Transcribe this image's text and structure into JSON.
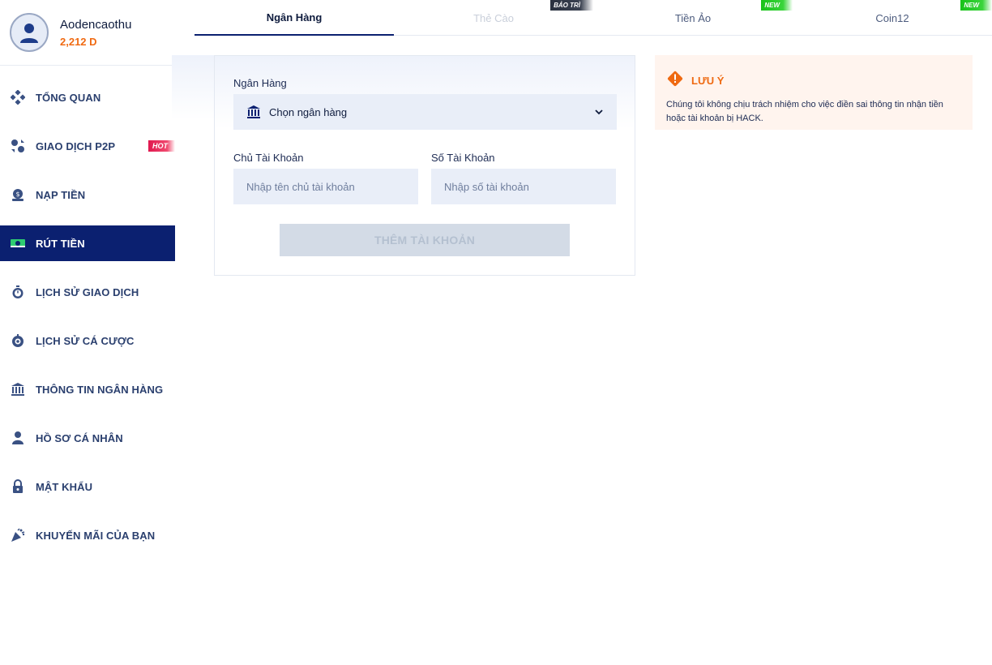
{
  "user": {
    "name": "Aodencaothu",
    "balance": "2,212 D"
  },
  "sidebar": {
    "items": [
      {
        "label": "TỔNG QUAN",
        "icon": "dashboard-icon"
      },
      {
        "label": "GIAO DỊCH P2P",
        "icon": "p2p-icon",
        "badge": "HOT"
      },
      {
        "label": "NẠP TIỀN",
        "icon": "deposit-icon"
      },
      {
        "label": "RÚT TIỀN",
        "icon": "withdraw-icon",
        "active": true
      },
      {
        "label": "LỊCH SỬ GIAO DỊCH",
        "icon": "stopwatch-icon"
      },
      {
        "label": "LỊCH SỬ CÁ CƯỢC",
        "icon": "bet-history-icon"
      },
      {
        "label": "THÔNG TIN NGÂN HÀNG",
        "icon": "bank-icon"
      },
      {
        "label": "HỒ SƠ CÁ NHÂN",
        "icon": "user-icon"
      },
      {
        "label": "MẬT KHẨU",
        "icon": "lock-icon"
      },
      {
        "label": "KHUYẾN MÃI CỦA BẠN",
        "icon": "promo-icon"
      }
    ]
  },
  "tabs": [
    {
      "label": "Ngân Hàng",
      "state": "active"
    },
    {
      "label": "Thẻ Cào",
      "state": "disabled",
      "badge": "BẢO TRÌ"
    },
    {
      "label": "Tiền Ảo",
      "state": "normal",
      "badge": "NEW"
    },
    {
      "label": "Coin12",
      "state": "normal",
      "badge": "NEW"
    }
  ],
  "form": {
    "bank_label": "Ngân Hàng",
    "bank_select_value": "Chọn ngân hàng",
    "owner_label": "Chủ Tài Khoản",
    "owner_placeholder": "Nhập tên chủ tài khoản",
    "number_label": "Số Tài Khoản",
    "number_placeholder": "Nhập số tài khoản",
    "submit_label": "THÊM TÀI KHOẢN"
  },
  "note": {
    "title": "LƯU Ý",
    "text": "Chúng tôi không chịu trách nhiệm cho việc điền sai thông tin nhận tiền hoặc tài khoản bị HACK."
  },
  "colors": {
    "accent": "#0b2070",
    "balance": "#f06a12",
    "hot": "#e0184f",
    "new": "#19c21a",
    "warning": "#ef6a12"
  }
}
